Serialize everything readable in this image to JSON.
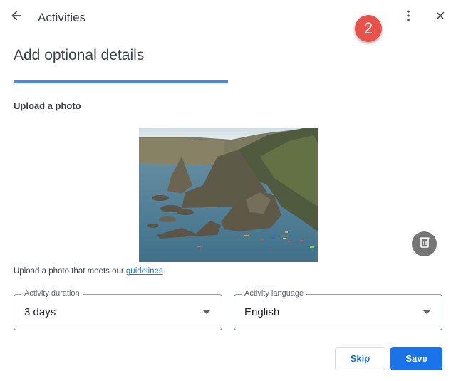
{
  "header": {
    "title": "Activities",
    "back_icon": "arrow-left-icon",
    "more_icon": "more-vert-icon",
    "close_icon": "close-icon"
  },
  "step_badge": "2",
  "page": {
    "title": "Add optional details",
    "progress_percent": 50
  },
  "upload": {
    "section_label": "Upload a photo",
    "photo_alt": "Coastal cliffs with sea stacks and kayakers",
    "delete_icon": "trash-icon",
    "helper_text": "Upload a photo that meets our ",
    "helper_link": "guidelines"
  },
  "fields": {
    "duration": {
      "label": "Activity duration",
      "value": "3 days"
    },
    "language": {
      "label": "Activity language",
      "value": "English"
    }
  },
  "actions": {
    "skip_label": "Skip",
    "save_label": "Save"
  },
  "colors": {
    "accent": "#1a73e8",
    "progress": "#4285f4",
    "badge": "#e8524a",
    "delete_button": "#757575"
  }
}
